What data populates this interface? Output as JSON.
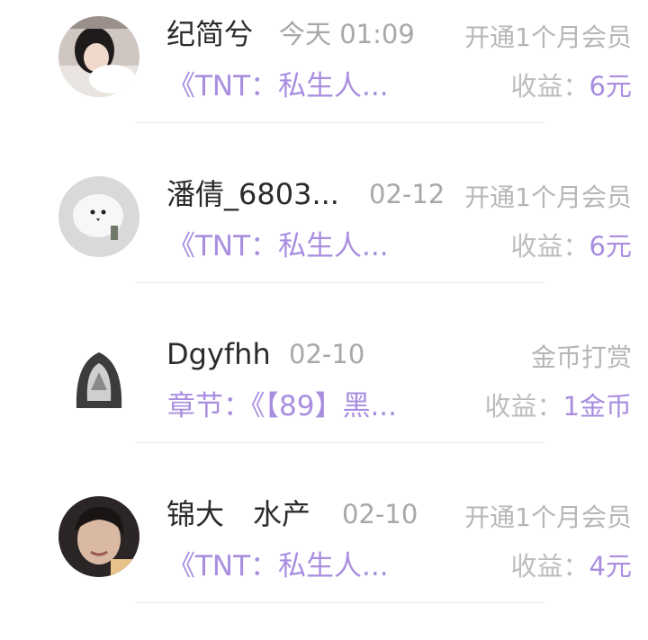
{
  "records": [
    {
      "name": "纪简兮",
      "time": "今天 01:09",
      "action": "开通1个月会员",
      "title": "《TNT：私生人...",
      "income_label": "收益：",
      "income_value": "6元"
    },
    {
      "name": "潘倩_6803...",
      "time": "02-12",
      "action": "开通1个月会员",
      "title": "《TNT：私生人...",
      "income_label": "收益：",
      "income_value": "6元"
    },
    {
      "name": "Dgyfhh",
      "time": "02-10",
      "action": "金币打赏",
      "title": "章节：《【89】黑...",
      "income_label": "收益：",
      "income_value": "1金币"
    },
    {
      "name": "锦大　水产",
      "time": "02-10",
      "action": "开通1个月会员",
      "title": "《TNT：私生人...",
      "income_label": "收益：",
      "income_value": "4元"
    }
  ],
  "colors": {
    "accent": "#a98ee0",
    "name": "#2b2b2b",
    "muted": "#b6b6b6"
  }
}
